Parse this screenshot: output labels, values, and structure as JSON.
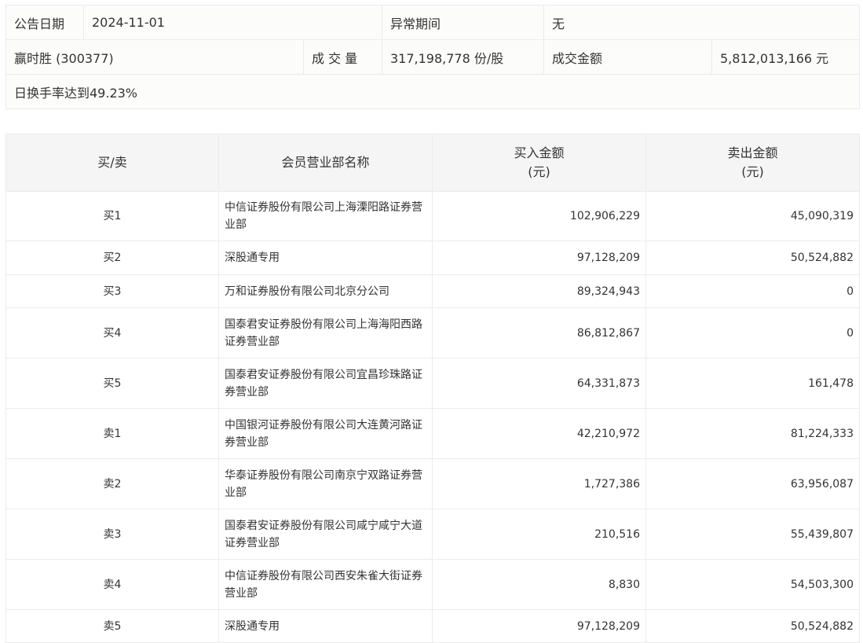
{
  "info": {
    "date_label": "公告日期",
    "date": "2024-11-01",
    "period_label": "异常期间",
    "period": "无",
    "stock": "赢时胜 (300377)",
    "volume_label": "成 交 量",
    "volume": "317,198,778 份/股",
    "amount_label": "成交金额",
    "amount": "5,812,013,166 元",
    "reason": "日换手率达到49.23%"
  },
  "table": {
    "headers": [
      "买/卖",
      "会员营业部名称",
      "买入金额\n(元)",
      "卖出金额\n(元)"
    ],
    "header_lines": {
      "buy": [
        "买入金额",
        "(元)"
      ],
      "sell": [
        "卖出金额",
        "(元)"
      ]
    },
    "rows": [
      {
        "side": "买1",
        "name": "中信证券股份有限公司上海溧阳路证券营业部",
        "buy": "102,906,229",
        "sell": "45,090,319"
      },
      {
        "side": "买2",
        "name": "深股通专用",
        "buy": "97,128,209",
        "sell": "50,524,882"
      },
      {
        "side": "买3",
        "name": "万和证券股份有限公司北京分公司",
        "buy": "89,324,943",
        "sell": "0"
      },
      {
        "side": "买4",
        "name": "国泰君安证券股份有限公司上海海阳西路证券营业部",
        "buy": "86,812,867",
        "sell": "0"
      },
      {
        "side": "买5",
        "name": "国泰君安证券股份有限公司宜昌珍珠路证券营业部",
        "buy": "64,331,873",
        "sell": "161,478"
      },
      {
        "side": "卖1",
        "name": "中国银河证券股份有限公司大连黄河路证券营业部",
        "buy": "42,210,972",
        "sell": "81,224,333"
      },
      {
        "side": "卖2",
        "name": "华泰证券股份有限公司南京宁双路证券营业部",
        "buy": "1,727,386",
        "sell": "63,956,087"
      },
      {
        "side": "卖3",
        "name": "国泰君安证券股份有限公司咸宁咸宁大道证券营业部",
        "buy": "210,516",
        "sell": "55,439,807"
      },
      {
        "side": "卖4",
        "name": "中信证券股份有限公司西安朱雀大街证券营业部",
        "buy": "8,830",
        "sell": "54,503,300"
      },
      {
        "side": "卖5",
        "name": "深股通专用",
        "buy": "97,128,209",
        "sell": "50,524,882"
      }
    ]
  }
}
